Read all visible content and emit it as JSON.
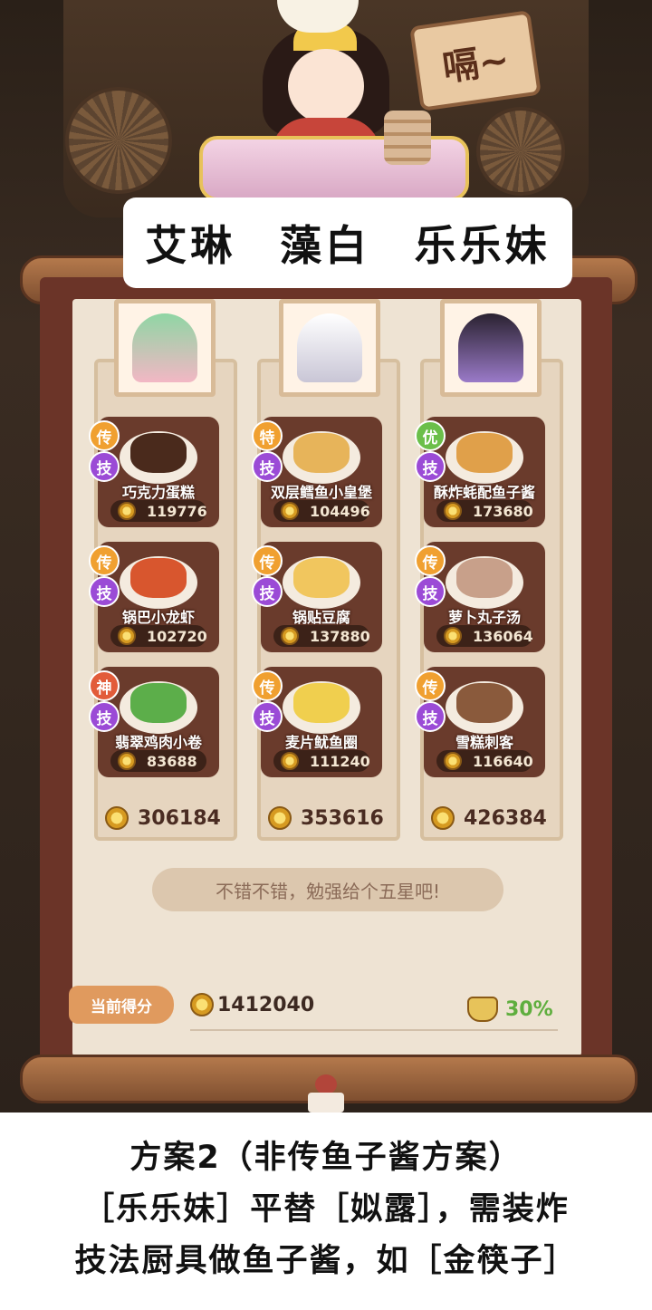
{
  "header": {
    "sign_text": "嗝~",
    "characters": [
      "艾琳",
      "藻白",
      "乐乐妹"
    ]
  },
  "columns": [
    {
      "total": "306184",
      "dishes": [
        {
          "tier": "传",
          "skill": "技",
          "name": "巧克力蛋糕",
          "score": "119776"
        },
        {
          "tier": "传",
          "skill": "技",
          "name": "锅巴小龙虾",
          "score": "102720"
        },
        {
          "tier": "神",
          "skill": "技",
          "name": "翡翠鸡肉小卷",
          "score": "83688"
        }
      ]
    },
    {
      "total": "353616",
      "dishes": [
        {
          "tier": "特",
          "skill": "技",
          "name": "双层鳕鱼小皇堡",
          "score": "104496"
        },
        {
          "tier": "传",
          "skill": "技",
          "name": "锅贴豆腐",
          "score": "137880"
        },
        {
          "tier": "传",
          "skill": "技",
          "name": "麦片鱿鱼圈",
          "score": "111240"
        }
      ]
    },
    {
      "total": "426384",
      "dishes": [
        {
          "tier": "优",
          "skill": "技",
          "name": "酥炸蚝配鱼子酱",
          "score": "173680"
        },
        {
          "tier": "传",
          "skill": "技",
          "name": "萝卜丸子汤",
          "score": "136064"
        },
        {
          "tier": "传",
          "skill": "技",
          "name": "雪糕刺客",
          "score": "116640"
        }
      ]
    }
  ],
  "comment": "不错不错，勉强给个五星吧!",
  "footer": {
    "current_label": "当前得分",
    "grand_total": "1412040",
    "percent": "30%"
  },
  "caption": {
    "line1": "方案2（非传鱼子酱方案）",
    "line2": "［乐乐妹］平替［姒露］，需装炸",
    "line3": "技法厨具做鱼子酱，如［金筷子］"
  },
  "colors": {
    "legend_tier": "#f0a030",
    "divine_tier": "#e25c3a",
    "special_tier": "#f0a030",
    "excellent_tier": "#6bbf4a",
    "skill_badge": "#9b4bd6"
  }
}
